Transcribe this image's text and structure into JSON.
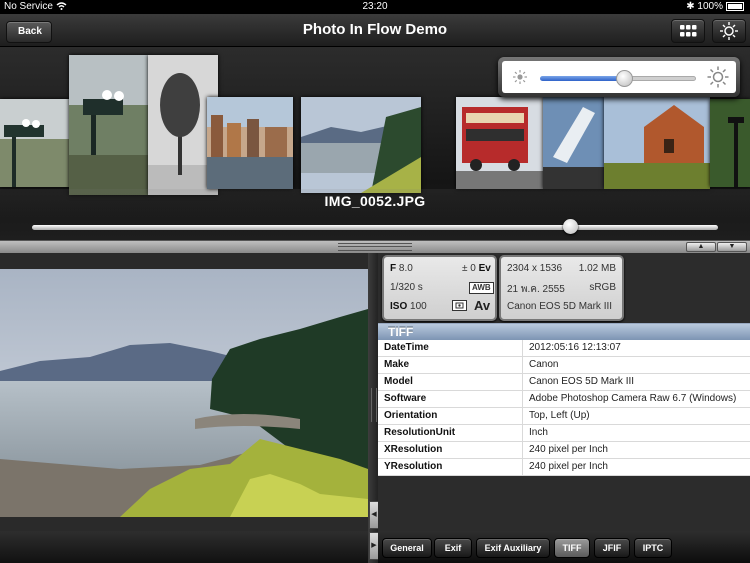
{
  "status_bar": {
    "carrier": "No Service",
    "time": "23:20",
    "battery": "100%"
  },
  "nav": {
    "back_label": "Back",
    "title": "Photo In Flow Demo",
    "grid_icon": "grid-icon",
    "brightness_icon": "sun-icon"
  },
  "coverflow": {
    "caption": "IMG_0052.JPG",
    "position": 0.78
  },
  "brightness": {
    "level": 0.55,
    "low_icon": "sun-small-icon",
    "high_icon": "sun-large-icon"
  },
  "divider": {
    "up_icon": "triangle-up-icon",
    "down_icon": "triangle-down-icon"
  },
  "exposure_card": {
    "f_label": "F",
    "f_value": "8.0",
    "ev_value": "± 0",
    "ev_label": "Ev",
    "shutter": "1/320 s",
    "wb": "AWB",
    "iso_label": "ISO",
    "iso_value": "100",
    "mode": "Av"
  },
  "image_card": {
    "dimensions": "2304 x 1536",
    "size": "1.02 MB",
    "date": "21 พ.ค. 2555",
    "colorspace": "sRGB",
    "camera": "Canon EOS 5D Mark III"
  },
  "section_title": "TIFF",
  "tiff_rows": [
    {
      "key": "DateTime",
      "value": "2012:05:16 12:13:07"
    },
    {
      "key": "Make",
      "value": "Canon"
    },
    {
      "key": "Model",
      "value": "Canon EOS 5D Mark III"
    },
    {
      "key": "Software",
      "value": "Adobe Photoshop Camera Raw 6.7 (Windows)"
    },
    {
      "key": "Orientation",
      "value": "Top, Left (Up)"
    },
    {
      "key": "ResolutionUnit",
      "value": "Inch"
    },
    {
      "key": "XResolution",
      "value": "240 pixel per Inch"
    },
    {
      "key": "YResolution",
      "value": "240 pixel per Inch"
    }
  ],
  "tabs": [
    {
      "label": "General",
      "selected": false
    },
    {
      "label": "Exif",
      "selected": false
    },
    {
      "label": "Exif Auxiliary",
      "selected": false
    },
    {
      "label": "TIFF",
      "selected": true
    },
    {
      "label": "JFIF",
      "selected": false
    },
    {
      "label": "IPTC",
      "selected": false
    }
  ]
}
